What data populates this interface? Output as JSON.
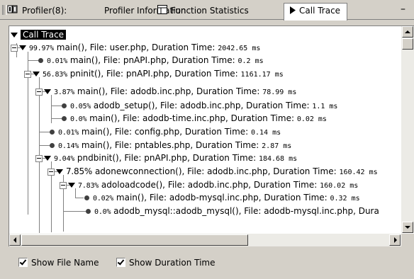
{
  "tabs": {
    "profiler": "Profiler(8):",
    "info": "Profiler Information",
    "stats": "Function Statistics",
    "trace": "Call Trace",
    "minimize": "–"
  },
  "tree": {
    "root": "Call Trace",
    "rows": [
      {
        "pct": "99.97%",
        "text": " main(), File: user.php, Duration Time: ",
        "dur": "2042.65 ms"
      },
      {
        "pct": "0.01%",
        "text": " main(), File: pnAPI.php, Duration Time: ",
        "dur": "0.2 ms"
      },
      {
        "pct": "56.83%",
        "text": " pninit(), File: pnAPI.php, Duration Time: ",
        "dur": "1161.17 ms"
      },
      {
        "pct": "3.87%",
        "text": " main(), File: adodb.inc.php, Duration Time: ",
        "dur": "78.99 ms"
      },
      {
        "pct": "0.05%",
        "text": " adodb_setup(), File: adodb.inc.php, Duration Time: ",
        "dur": "1.1 ms"
      },
      {
        "pct": "0.0%",
        "text": " main(), File: adodb-time.inc.php, Duration Time: ",
        "dur": "0.02 ms"
      },
      {
        "pct": "0.01%",
        "text": " main(), File: config.php, Duration Time: ",
        "dur": "0.14 ms"
      },
      {
        "pct": "0.14%",
        "text": " main(), File: pntables.php, Duration Time: ",
        "dur": "2.87 ms"
      },
      {
        "pct": "9.04%",
        "text": " pndbinit(), File: pnAPI.php, Duration Time: ",
        "dur": "184.68 ms"
      },
      {
        "pct": "7.85%",
        "text": " adonewconnection(), File: adodb.inc.php, Duration Time: ",
        "dur": "160.42 ms"
      },
      {
        "pct": "7.83%",
        "text": " adoloadcode(), File: adodb.inc.php, Duration Time: ",
        "dur": "160.02 ms"
      },
      {
        "pct": "0.02%",
        "text": " main(), File: adodb-mysql.inc.php, Duration Time: ",
        "dur": "0.32 ms"
      },
      {
        "pct": "0.0%",
        "text": " adodb_mysql::adodb_mysql(), File: adodb-mysql.inc.php, Dura",
        "dur": ""
      }
    ]
  },
  "options": {
    "show_file_name": "Show File Name",
    "show_duration_time": "Show Duration Time"
  }
}
